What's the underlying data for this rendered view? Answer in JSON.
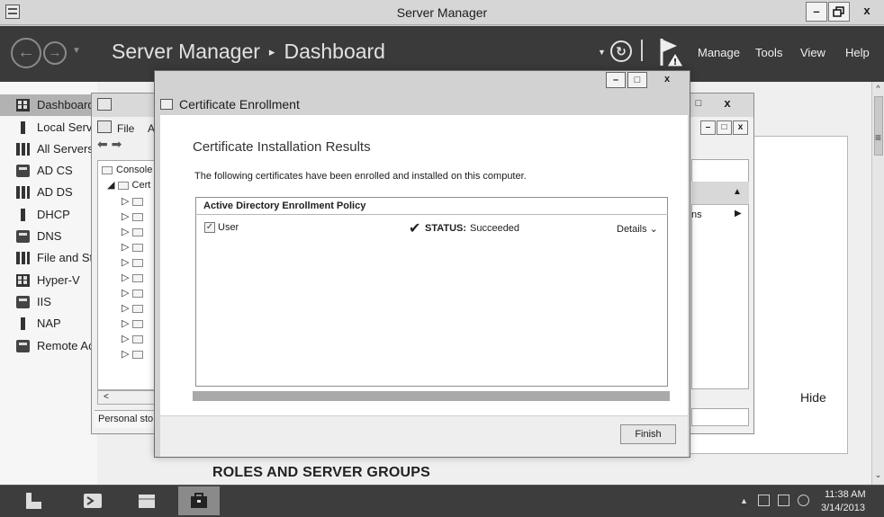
{
  "window": {
    "title": "Server Manager",
    "min_label": "–",
    "max_label": "□",
    "close_label": "x"
  },
  "header": {
    "breadcrumb_root": "Server Manager",
    "breadcrumb_sep": "▸",
    "breadcrumb_page": "Dashboard",
    "menus": [
      "Manage",
      "Tools",
      "View",
      "Help"
    ]
  },
  "sidebar": {
    "items": [
      {
        "label": "Dashboard",
        "icon": "dashboard-icon",
        "selected": true
      },
      {
        "label": "Local Server",
        "icon": "local-server-icon"
      },
      {
        "label": "All Servers",
        "icon": "all-servers-icon"
      },
      {
        "label": "AD CS",
        "icon": "ad-cs-icon"
      },
      {
        "label": "AD DS",
        "icon": "ad-ds-icon"
      },
      {
        "label": "DHCP",
        "icon": "dhcp-icon"
      },
      {
        "label": "DNS",
        "icon": "dns-icon"
      },
      {
        "label": "File and Storage Services",
        "icon": "file-storage-icon"
      },
      {
        "label": "Hyper-V",
        "icon": "hyper-v-icon"
      },
      {
        "label": "IIS",
        "icon": "iis-icon"
      },
      {
        "label": "NAP",
        "icon": "nap-icon"
      },
      {
        "label": "Remote Access",
        "icon": "remote-access-icon"
      }
    ]
  },
  "main": {
    "hide_link": "Hide",
    "roles_heading": "ROLES AND SERVER GROUPS"
  },
  "console": {
    "menu_file": "File",
    "menu_action": "A",
    "tree_root": "Console",
    "tree_child": "Cert",
    "status_text": "Personal sto",
    "scroll_left": "<",
    "actions_more": "ns"
  },
  "dialog": {
    "title": "Certificate Enrollment",
    "heading": "Certificate Installation Results",
    "description": "The following certificates have been enrolled and installed on this computer.",
    "policy_title": "Active Directory Enrollment Policy",
    "certificate": {
      "name": "User",
      "checked": true,
      "status_label": "STATUS:",
      "status_value": "Succeeded",
      "details_label": "Details ⌄"
    },
    "progress_fraction": 1.0,
    "finish_label": "Finish"
  },
  "taskbar": {
    "apps": [
      "server-manager-icon",
      "powershell-icon",
      "file-explorer-icon",
      "toolbox-icon"
    ],
    "clock_time": "11:38 AM",
    "clock_date": "3/14/2013"
  }
}
